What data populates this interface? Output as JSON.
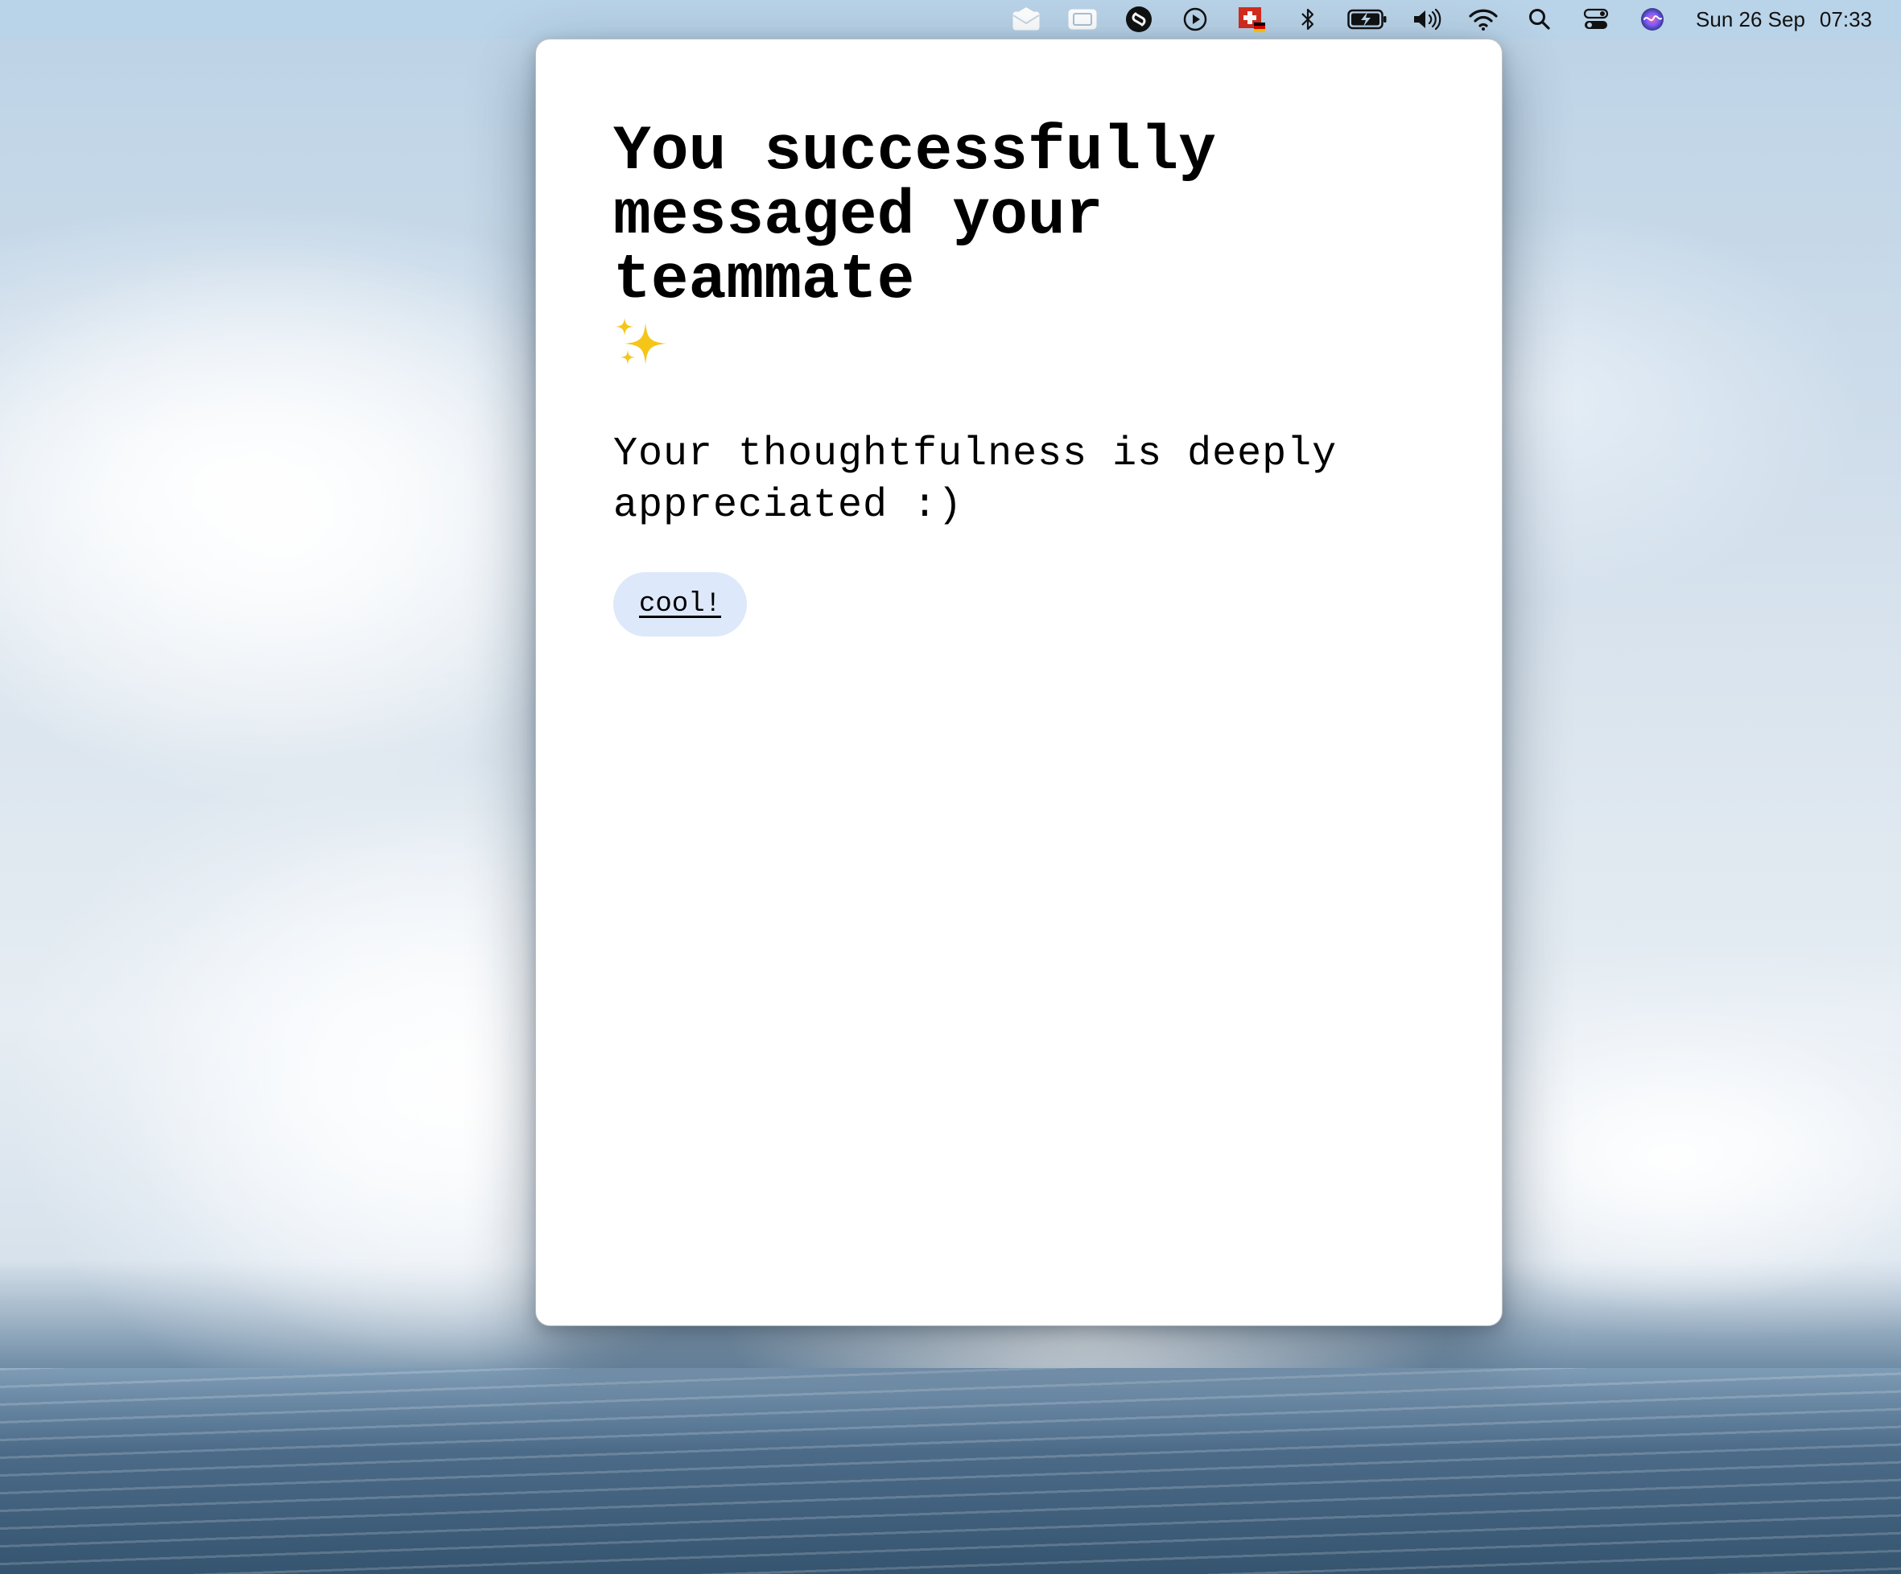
{
  "menubar": {
    "icons": [
      "mail-icon",
      "screen-mirror-icon",
      "shazam-icon",
      "play-circle-icon",
      "swiss-flag-icon",
      "bluetooth-icon",
      "battery-charging-icon",
      "volume-icon",
      "wifi-icon",
      "search-icon",
      "control-center-icon",
      "siri-icon"
    ],
    "date": "Sun 26 Sep",
    "time": "07:33"
  },
  "dialog": {
    "title": "You successfully messaged your teammate",
    "title_emoji_icon": "sparkles-icon",
    "message": "Your thoughtfulness is deeply appreciated :)",
    "button_label": "cool!"
  },
  "colors": {
    "dialog_background": "#ffffff",
    "button_background": "#dde8fa",
    "sparkles": "#f5c518",
    "menubar_background": "#b8d2e8",
    "swiss_flag_red": "#d52b1e"
  }
}
